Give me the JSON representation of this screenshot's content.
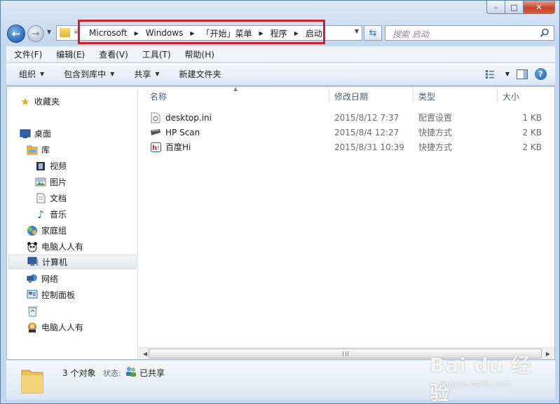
{
  "window": {
    "caption": {
      "minimize": "–",
      "maximize": "□",
      "close": "✕"
    }
  },
  "address": {
    "crumbs": [
      "Microsoft",
      "Windows",
      "「开始」菜单",
      "程序",
      "启动"
    ],
    "overflow": "«"
  },
  "search": {
    "placeholder": "搜索 启动"
  },
  "menu": [
    "文件(F)",
    "编辑(E)",
    "查看(V)",
    "工具(T)",
    "帮助(H)"
  ],
  "toolbar": {
    "organize": "组织",
    "include_in_library": "包含到库中",
    "share": "共享",
    "new_folder": "新建文件夹"
  },
  "nav": {
    "favorites": "收藏夹",
    "desktop": "桌面",
    "libraries": "库",
    "videos": "视频",
    "pictures": "图片",
    "documents": "文档",
    "music": "音乐",
    "homegroup": "家庭组",
    "user1": "电脑人人有",
    "computer": "计算机",
    "network": "网络",
    "control_panel": "控制面板",
    "user2": "电脑人人有"
  },
  "columns": {
    "name": "名称",
    "date": "修改日期",
    "type": "类型",
    "size": "大小"
  },
  "files": [
    {
      "name": "desktop.ini",
      "date": "2015/8/12 7:37",
      "type": "配置设置",
      "size": "1 KB",
      "icon": "settings-file-icon"
    },
    {
      "name": "HP Scan",
      "date": "2015/8/4 12:27",
      "type": "快捷方式",
      "size": "2 KB",
      "icon": "scanner-shortcut-icon"
    },
    {
      "name": "百度Hi",
      "date": "2015/8/31 10:39",
      "type": "快捷方式",
      "size": "2 KB",
      "icon": "baidu-hi-icon"
    }
  ],
  "details": {
    "count": "3 个对象",
    "status_label": "状态:",
    "status_value": "已共享"
  },
  "watermark": {
    "brand": "Bai du 经验",
    "site": "jingyan.baidu.com"
  },
  "colors": {
    "highlight": "#d0202b",
    "accent": "#2d6bb8"
  }
}
